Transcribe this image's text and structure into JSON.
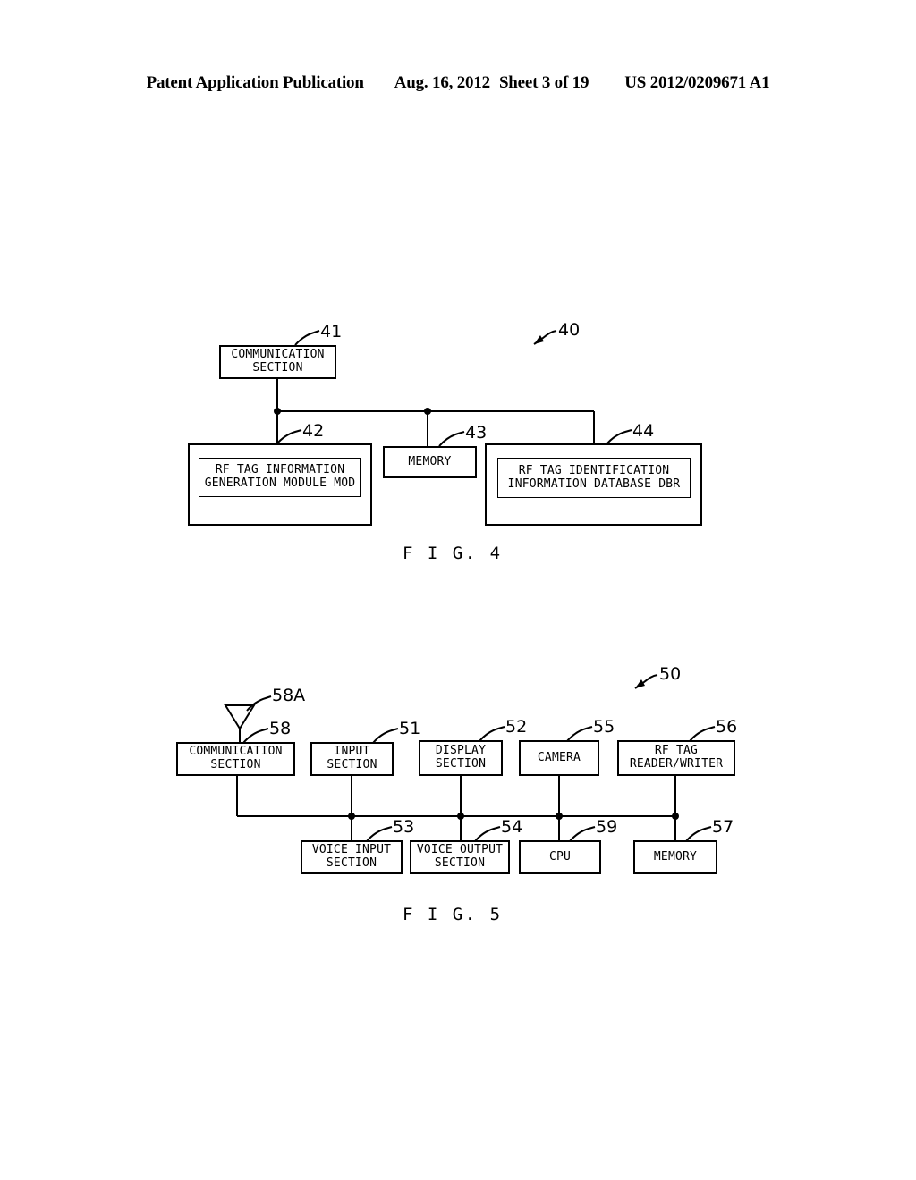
{
  "header": {
    "publication": "Patent Application Publication",
    "date": "Aug. 16, 2012",
    "sheet": "Sheet 3 of 19",
    "docnum": "US 2012/0209671 A1"
  },
  "figure4": {
    "caption": "F I G. 4",
    "assembly_ref": "40",
    "blocks": {
      "communication_section": {
        "ref": "41",
        "label": "COMMUNICATION\nSECTION"
      },
      "rf_tag_info_gen_module": {
        "ref": "42",
        "label": "RF TAG INFORMATION\nGENERATION MODULE MOD"
      },
      "memory": {
        "ref": "43",
        "label": "MEMORY"
      },
      "rf_tag_id_info_db": {
        "ref": "44",
        "label": "RF TAG IDENTIFICATION\nINFORMATION DATABASE DBR"
      }
    }
  },
  "figure5": {
    "caption": "F I G. 5",
    "assembly_ref": "50",
    "blocks": {
      "antenna": {
        "ref": "58A",
        "label": ""
      },
      "communication_section": {
        "ref": "58",
        "label": "COMMUNICATION\nSECTION"
      },
      "input_section": {
        "ref": "51",
        "label": "INPUT\nSECTION"
      },
      "display_section": {
        "ref": "52",
        "label": "DISPLAY\nSECTION"
      },
      "camera": {
        "ref": "55",
        "label": "CAMERA"
      },
      "rf_tag_reader_writer": {
        "ref": "56",
        "label": "RF TAG\nREADER/WRITER"
      },
      "voice_input_section": {
        "ref": "53",
        "label": "VOICE INPUT\nSECTION"
      },
      "voice_output_section": {
        "ref": "54",
        "label": "VOICE OUTPUT\nSECTION"
      },
      "cpu": {
        "ref": "59",
        "label": "CPU"
      },
      "memory": {
        "ref": "57",
        "label": "MEMORY"
      }
    }
  },
  "colors": {
    "ink": "#000000",
    "paper": "#ffffff"
  }
}
